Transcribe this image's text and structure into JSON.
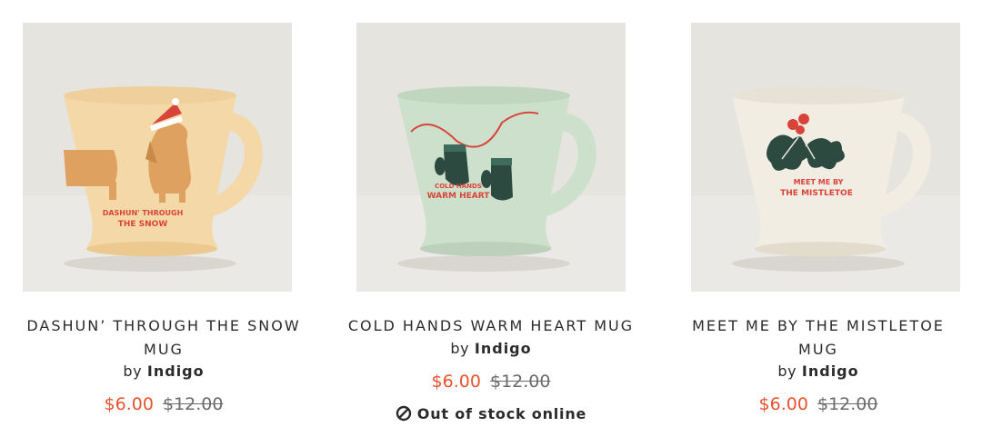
{
  "products": [
    {
      "title_line1": "DASHUN’ THROUGH THE SNOW",
      "title_line2": "MUG",
      "by_prefix": "by",
      "brand": "Indigo",
      "sale_price": "$6.00",
      "original_price": "$12.00",
      "mug_color": "#f5d8a7",
      "mug_text_line1": "DASHUN' THROUGH",
      "mug_text_line2": "THE SNOW"
    },
    {
      "title_line1": "COLD HANDS WARM HEART MUG",
      "by_prefix": "by",
      "brand": "Indigo",
      "sale_price": "$6.00",
      "original_price": "$12.00",
      "stock_status": "Out of stock online",
      "mug_color": "#cde0cc",
      "mug_text_line1": "COLD HANDS",
      "mug_text_line2": "WARM HEART"
    },
    {
      "title_line1": "MEET ME BY THE MISTLETOE",
      "title_line2": "MUG",
      "by_prefix": "by",
      "brand": "Indigo",
      "sale_price": "$6.00",
      "original_price": "$12.00",
      "mug_color": "#f2ede3",
      "mug_text_line1": "MEET ME BY",
      "mug_text_line2": "THE MISTLETOE"
    }
  ],
  "colors": {
    "sale": "#e8542f",
    "text": "#2b2b2b",
    "strike": "#6b6b6b"
  }
}
